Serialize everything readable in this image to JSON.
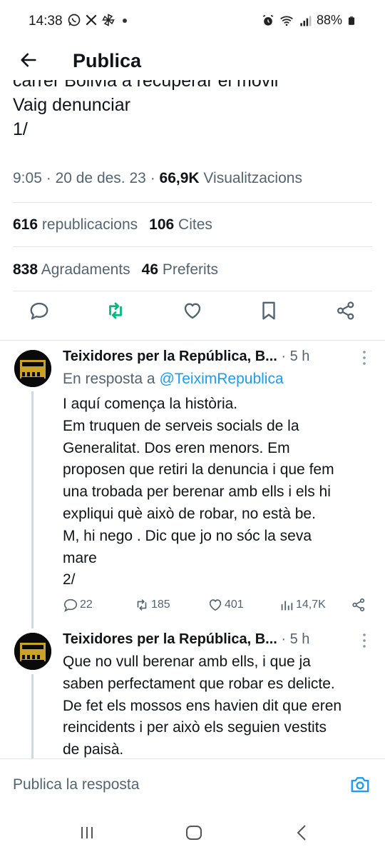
{
  "status_bar": {
    "time": "14:38",
    "battery": "88%",
    "app_icons": [
      "whatsapp-icon",
      "x-icon",
      "pinwheel-icon"
    ],
    "system_icons": [
      "alarm-icon",
      "wifi-icon",
      "signal-icon",
      "battery-icon"
    ]
  },
  "header": {
    "title": "Publica"
  },
  "tweet": {
    "text_cut": "carrer Bolivia a recuperar el mòvil",
    "text_line2": "Vaig denunciar",
    "text_line3": "1/",
    "time": "9:05",
    "date": "20 de des. 23",
    "views_count": "66,9K",
    "views_label": "Visualitzacions",
    "reposts_count": "616",
    "reposts_label": "republicacions",
    "quotes_count": "106",
    "quotes_label": "Cites",
    "likes_count": "838",
    "likes_label": "Agradaments",
    "bookmarks_count": "46",
    "bookmarks_label": "Preferits",
    "accent_color": "#00ba7c"
  },
  "replies": [
    {
      "name": "Teixidores per la República, B...",
      "time": "· 5 h",
      "in_reply_prefix": "En resposta a",
      "in_reply_handle": "@TeiximRepublica",
      "lines": [
        "I aquí comença la història.",
        "Em truquen de serveis socials de la",
        "Generalitat. Dos eren menors. Em",
        "proposen que retiri la denuncia i que fem",
        "una trobada per berenar amb ells i els hi",
        "expliqui què això de robar, no està be.",
        "M, hi nego . Dic que jo no sóc la seva",
        "mare",
        "2/"
      ],
      "replies_count": "22",
      "reposts_count": "185",
      "likes_count": "401",
      "views_count": "14,7K"
    },
    {
      "name": "Teixidores per la República, B...",
      "time": "· 5 h",
      "lines": [
        "Que no vull berenar amb ells, i que ja",
        "saben perfectament que robar es delicte.",
        "De fet els mossos ens havien dit que eren",
        "reincidents i per això els seguien vestits",
        "de paisà."
      ]
    }
  ],
  "composer": {
    "placeholder": "Publica la resposta"
  },
  "colors": {
    "link": "#1d9bf0",
    "secondary_text": "#536471",
    "primary_text": "#0f1419"
  }
}
